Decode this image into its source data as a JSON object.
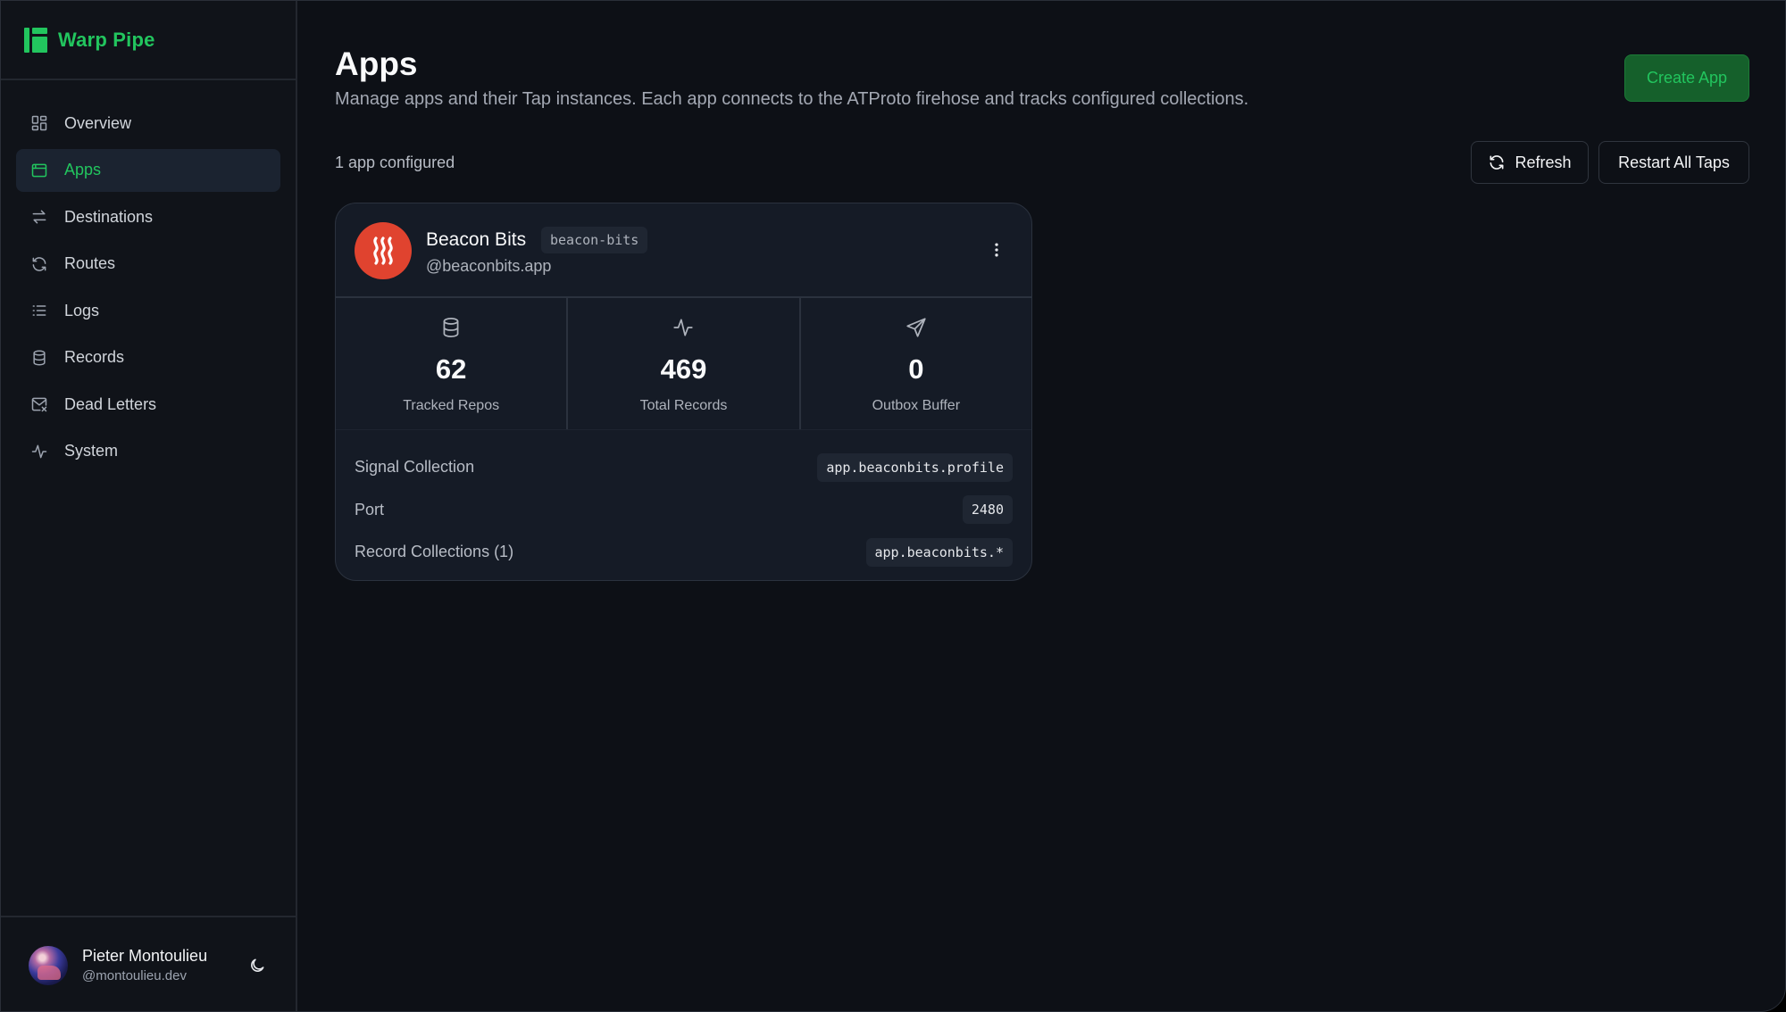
{
  "brand": {
    "name": "Warp Pipe",
    "color": "#22c55e"
  },
  "sidebar": {
    "items": [
      {
        "label": "Overview",
        "icon": "dashboard-icon"
      },
      {
        "label": "Apps",
        "icon": "window-icon",
        "active": true
      },
      {
        "label": "Destinations",
        "icon": "arrows-exchange-icon"
      },
      {
        "label": "Routes",
        "icon": "refresh-icon"
      },
      {
        "label": "Logs",
        "icon": "list-icon"
      },
      {
        "label": "Records",
        "icon": "database-icon"
      },
      {
        "label": "Dead Letters",
        "icon": "mail-x-icon"
      },
      {
        "label": "System",
        "icon": "activity-icon"
      }
    ]
  },
  "user": {
    "name": "Pieter Montoulieu",
    "handle": "@montoulieu.dev",
    "theme_icon": "moon-icon"
  },
  "header": {
    "title": "Apps",
    "description": "Manage apps and their Tap instances. Each app connects to the ATProto firehose and tracks configured collections.",
    "create_label": "Create App"
  },
  "toolbar": {
    "count_text": "1 app configured",
    "refresh_label": "Refresh",
    "restart_label": "Restart All Taps"
  },
  "app_card": {
    "name": "Beacon Bits",
    "slug": "beacon-bits",
    "handle": "@beaconbits.app",
    "logo_color": "#e0432f",
    "stats": [
      {
        "value": "62",
        "label": "Tracked Repos",
        "icon": "database-icon"
      },
      {
        "value": "469",
        "label": "Total Records",
        "icon": "activity-icon"
      },
      {
        "value": "0",
        "label": "Outbox Buffer",
        "icon": "send-icon"
      }
    ],
    "details": [
      {
        "label": "Signal Collection",
        "value": "app.beaconbits.profile"
      },
      {
        "label": "Port",
        "value": "2480"
      },
      {
        "label": "Record Collections (1)",
        "value": "app.beaconbits.*"
      }
    ]
  }
}
